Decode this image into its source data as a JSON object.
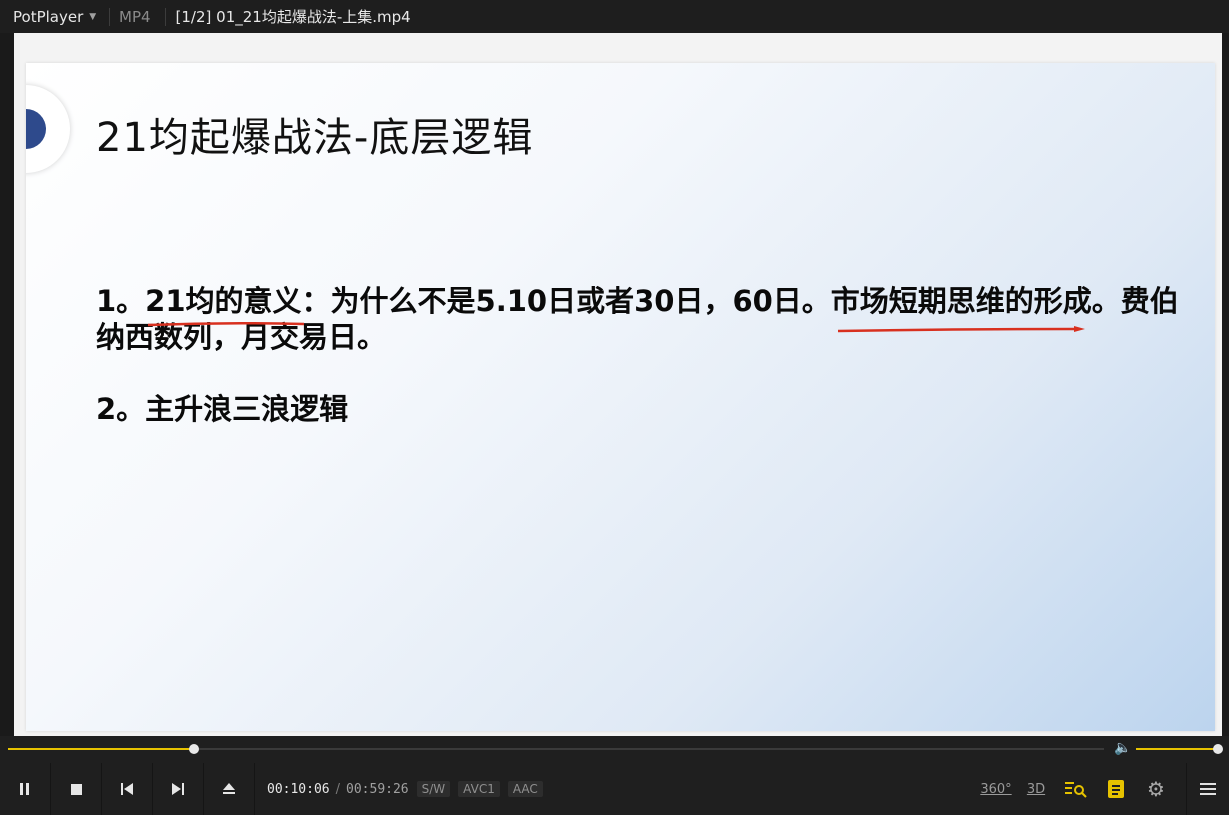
{
  "window": {
    "app_name": "PotPlayer",
    "format": "MP4",
    "file_title": "[1/2] 01_21均起爆战法-上集.mp4"
  },
  "slide": {
    "title": "21均起爆战法-底层逻辑",
    "point1": "1。21均的意义：为什么不是5.10日或者30日，60日。市场短期思维的形成。费伯纳西数列，月交易日。",
    "point2": "2。主升浪三浪逻辑",
    "annotation_color": "#d8301f"
  },
  "player": {
    "current_time": "00:10:06",
    "separator": "/",
    "duration": "00:59:26",
    "badges": [
      "S/W",
      "AVC1",
      "AAC"
    ],
    "progress_fraction": 0.17,
    "volume_fraction": 1.0,
    "accent_color": "#e6c200",
    "labels": {
      "three_sixty": "360°",
      "three_d": "3D"
    }
  },
  "icons": {
    "pause": "pause-icon",
    "stop": "stop-icon",
    "prev": "previous-icon",
    "next": "next-icon",
    "eject": "eject-icon",
    "volume": "volume-icon",
    "playlist_search": "playlist-search-icon",
    "subtitle": "subtitle-icon",
    "settings": "gear-icon",
    "menu": "hamburger-menu-icon"
  }
}
